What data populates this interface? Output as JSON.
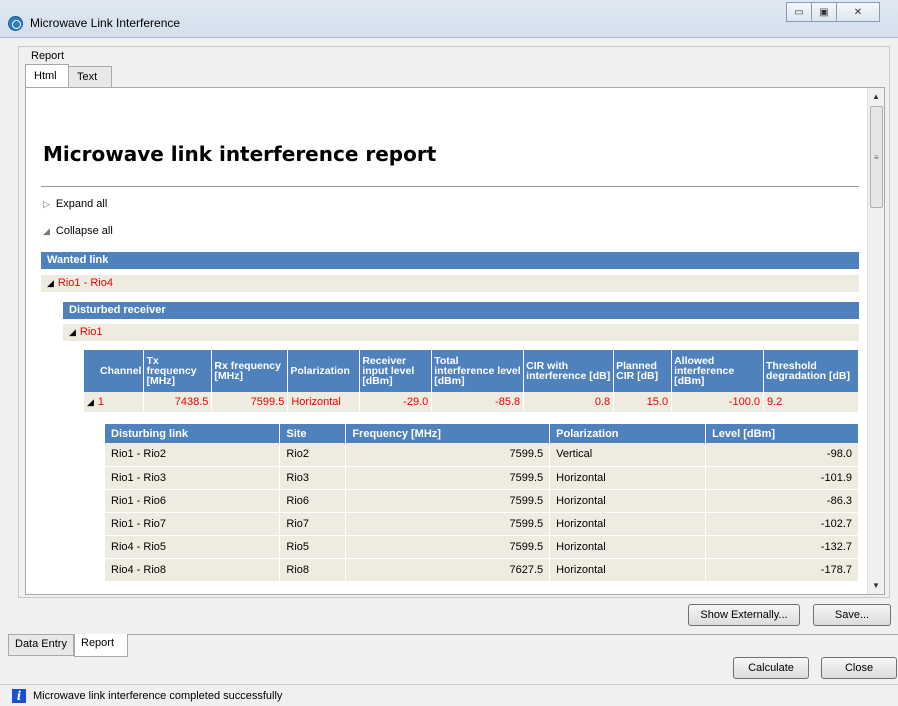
{
  "window": {
    "title": "Microwave Link Interference"
  },
  "report_group_label": "Report",
  "top_tabs": [
    {
      "label": "Html"
    },
    {
      "label": "Text"
    }
  ],
  "report": {
    "title": "Microwave link interference report",
    "expand_all": "Expand all",
    "collapse_all": "Collapse all",
    "wanted_link_header": "Wanted link",
    "wanted_link_value": "Rio1 - Rio4",
    "disturbed_receiver_header": "Disturbed receiver",
    "disturbed_receiver_value": "Rio1",
    "channel_headers": [
      "Channel",
      "Tx frequency [MHz]",
      "Rx frequency [MHz]",
      "Polarization",
      "Receiver input level [dBm]",
      "Total interference level [dBm]",
      "CIR with interference [dB]",
      "Planned CIR [dB]",
      "Allowed interference [dBm]",
      "Threshold degradation [dB]"
    ],
    "channel_row": {
      "channel": "1",
      "tx": "7438.5",
      "rx": "7599.5",
      "polarization": "Horizontal",
      "rx_level": "-29.0",
      "total_interference": "-85.8",
      "cir": "0.8",
      "planned_cir": "15.0",
      "allowed": "-100.0",
      "threshold": "9.2"
    },
    "disturbing_headers": [
      "Disturbing link",
      "Site",
      "Frequency [MHz]",
      "Polarization",
      "Level [dBm]"
    ],
    "disturbing_rows": [
      {
        "link": "Rio1 - Rio2",
        "site": "Rio2",
        "freq": "7599.5",
        "pol": "Vertical",
        "level": "-98.0"
      },
      {
        "link": "Rio1 - Rio3",
        "site": "Rio3",
        "freq": "7599.5",
        "pol": "Horizontal",
        "level": "-101.9"
      },
      {
        "link": "Rio1 - Rio6",
        "site": "Rio6",
        "freq": "7599.5",
        "pol": "Horizontal",
        "level": "-86.3"
      },
      {
        "link": "Rio1 - Rio7",
        "site": "Rio7",
        "freq": "7599.5",
        "pol": "Horizontal",
        "level": "-102.7"
      },
      {
        "link": "Rio4 - Rio5",
        "site": "Rio5",
        "freq": "7599.5",
        "pol": "Horizontal",
        "level": "-132.7"
      },
      {
        "link": "Rio4 - Rio8",
        "site": "Rio8",
        "freq": "7627.5",
        "pol": "Horizontal",
        "level": "-178.7"
      }
    ]
  },
  "buttons": {
    "show_externally": "Show Externally...",
    "save": "Save...",
    "calculate": "Calculate",
    "close": "Close"
  },
  "bottom_tabs": [
    {
      "label": "Data Entry"
    },
    {
      "label": "Report"
    }
  ],
  "status": {
    "text": "Microwave link interference completed successfully"
  }
}
